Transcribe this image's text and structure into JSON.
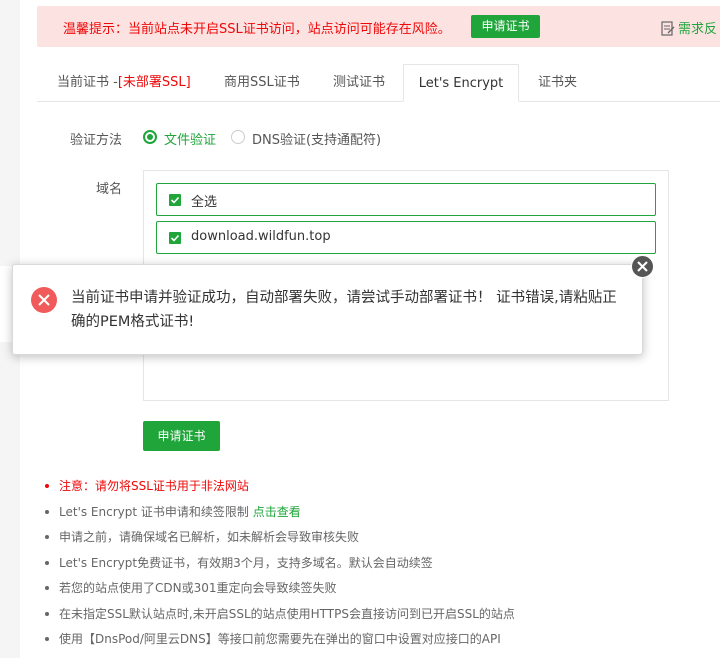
{
  "warning": {
    "text": "温馨提示：当前站点未开启SSL证书访问，站点访问可能存在风险。",
    "button": "申请证书",
    "feedback": "需求反"
  },
  "tabs": [
    {
      "label": "当前证书 -",
      "suffix": "[未部署SSL]"
    },
    {
      "label": "商用SSL证书"
    },
    {
      "label": "测试证书"
    },
    {
      "label": "Let's Encrypt",
      "active": true
    },
    {
      "label": "证书夹"
    }
  ],
  "form": {
    "verify_label": "验证方法",
    "option_file": "文件验证",
    "option_dns": "DNS验证(支持通配符)",
    "domain_label": "域名",
    "select_all": "全选",
    "domain": "download.wildfun.top",
    "apply_button": "申请证书"
  },
  "notes": [
    {
      "text": "注意：请勿将SSL证书用于非法网站"
    },
    {
      "text": "Let's Encrypt 证书申请和续签限制 ",
      "link": "点击查看"
    },
    {
      "text": "申请之前，请确保域名已解析，如未解析会导致审核失败"
    },
    {
      "text": "Let's Encrypt免费证书，有效期3个月，支持多域名。默认会自动续签"
    },
    {
      "text": "若您的站点使用了CDN或301重定向会导致续签失败"
    },
    {
      "text": "在未指定SSL默认站点时,未开启SSL的站点使用HTTPS会直接访问到已开启SSL的站点"
    },
    {
      "text": "使用【DnsPod/阿里云DNS】等接口前您需要先在弹出的窗口中设置对应接口的API"
    }
  ],
  "popup": {
    "message": "当前证书申请并验证成功，自动部署失败，请尝试手动部署证书！ 证书错误,请粘贴正确的PEM格式证书!"
  },
  "colors": {
    "accent": "#20a53a",
    "danger": "#ef0808",
    "error_icon": "#f05a5a"
  }
}
